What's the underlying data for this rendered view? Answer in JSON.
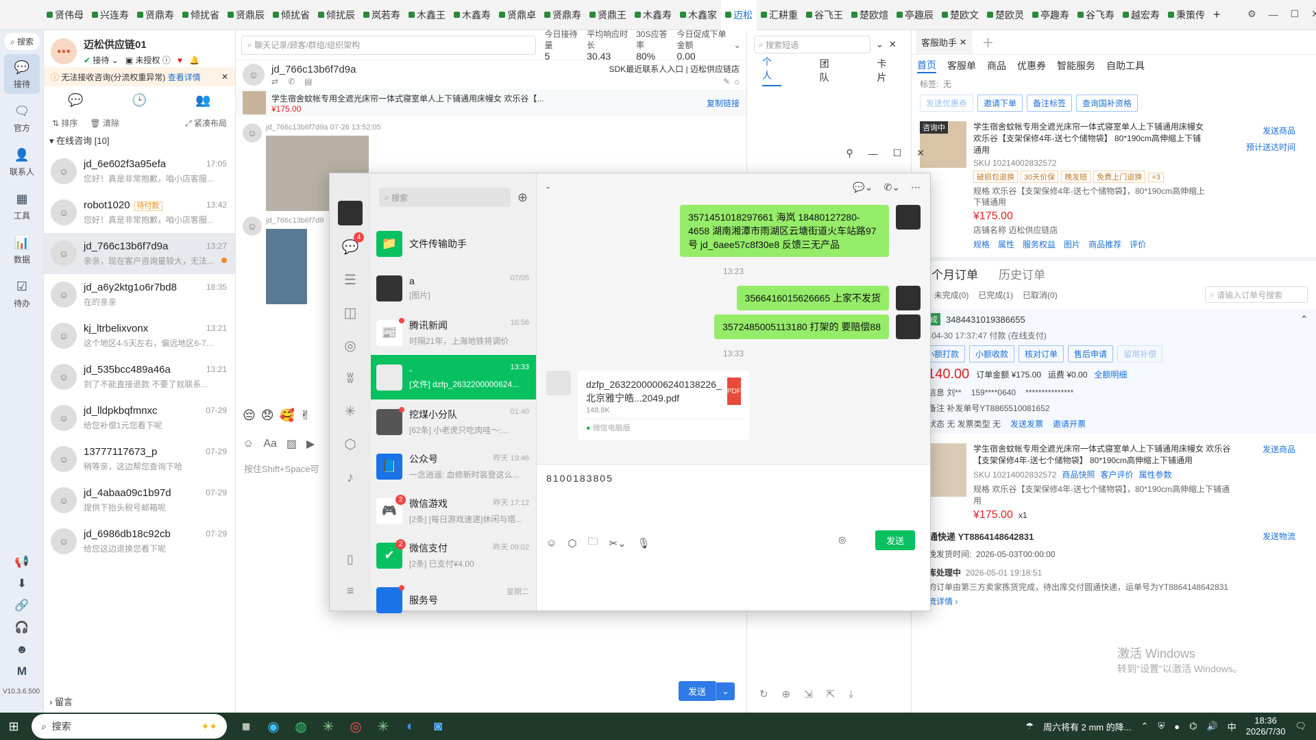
{
  "shop_tabs": [
    "贤伟母",
    "兴连寿",
    "贤鼎寿",
    "倾扰省",
    "贤鼎辰",
    "倾扰省",
    "倾扰辰",
    "岚若寿",
    "木鑫王",
    "木鑫寿",
    "贤鼎卓",
    "贤鼎寿",
    "贤鼎王",
    "木鑫寿",
    "木鑫家",
    "迈松",
    "汇耕重",
    "谷飞王",
    "楚欧煊",
    "亭趣辰",
    "楚欧文",
    "楚欧灵",
    "亭趣寿",
    "谷飞寿",
    "越宏寿",
    "秉策传"
  ],
  "active_tab": "迈松",
  "rail": {
    "search": "搜索",
    "items": [
      {
        "label": "接待",
        "icon": "chat-icon"
      },
      {
        "label": "官方",
        "icon": "message-icon"
      },
      {
        "label": "联系人",
        "icon": "contact-icon"
      },
      {
        "label": "工具",
        "icon": "tools-icon"
      },
      {
        "label": "数据",
        "icon": "data-icon"
      },
      {
        "label": "待办",
        "icon": "todo-icon"
      }
    ],
    "version": "V10.3.6.500",
    "bottom_letter": "M"
  },
  "store": {
    "name": "迈松供应链01",
    "status": "接待",
    "auth": "未授权",
    "warning": "无法接收咨询(分流权重异常)",
    "warning_link": "查看详情",
    "sort": "排序",
    "clear": "清除",
    "layout": "紧凑布局",
    "group": "在线咨询 [10]",
    "leave_msg": "留言"
  },
  "conversations": [
    {
      "name": "jd_6e602f3a95efa",
      "msg": "您好！真是非常抱歉，咱小店客服...",
      "time": "17:05"
    },
    {
      "name": "robot1020",
      "tag": "待付款",
      "msg": "您好！真是非常抱歉，咱小店客服...",
      "time": "13:42"
    },
    {
      "name": "jd_766c13b6f7d9a",
      "msg": "亲亲，现在客户咨询量较大，无法...",
      "time": "13:27"
    },
    {
      "name": "jd_a6y2ktg1o6r7bd8",
      "msg": "在的亲亲",
      "time": "18:35"
    },
    {
      "name": "kj_ltrbelixvonx",
      "msg": "这个地区4-5天左右，偏远地区6-7...",
      "time": "13:21"
    },
    {
      "name": "jd_535bcc489a46a",
      "msg": "到了不能直接退款 不要了就联系...",
      "time": "13:21"
    },
    {
      "name": "jd_lldpkbqfmnxc",
      "msg": "给您补偿1元您看下呢",
      "time": "07-29"
    },
    {
      "name": "13777117673_p",
      "msg": "稍等亲，这边帮您查询下哈",
      "time": "07-29"
    },
    {
      "name": "jd_4abaa09c1b97d",
      "msg": "提供下抬头税号邮箱呢",
      "time": "07-29"
    },
    {
      "name": "jd_6986db18c92cb",
      "msg": "给您这边退换您看下呢",
      "time": "07-29"
    }
  ],
  "chat": {
    "search_placeholder": "聊天记录/顾客/群组/组织架构",
    "stats": [
      {
        "label": "今日接待量",
        "value": "5"
      },
      {
        "label": "平均响应时长",
        "value": "30.43"
      },
      {
        "label": "30S应答率",
        "value": "80%"
      },
      {
        "label": "今日促成下单金额",
        "value": "0.00"
      }
    ],
    "customer": "jd_766c13b6f7d9a",
    "sdk_link": "SDK最近联系人入口",
    "shop_label": "迈松供应链店",
    "product_title": "学生宿舍蚊帐专用全遮光床帘一体式寝室单人上下铺通用床幔女 欢乐谷【...",
    "product_price": "¥175.00",
    "copy_link": "复制链接",
    "msg_user": "jd_766c13b6f7d9a",
    "msg_time": "07-26 13:52:05",
    "msg_user2": "jd_766c13b6f7d9",
    "input_hint": "按住Shift+Space可",
    "send": "发送"
  },
  "sidetools": {
    "search_placeholder": "搜索短语",
    "tabs": [
      "个人",
      "团队",
      "卡片"
    ]
  },
  "right": {
    "tab_title": "客服助手",
    "nav": [
      "首页",
      "客服单",
      "商品",
      "优惠券",
      "智能服务",
      "自助工具"
    ],
    "tag_label": "标签:",
    "tag_value": "无",
    "actions": [
      "发送优惠券",
      "邀请下单",
      "备注标签",
      "查询国补资格"
    ],
    "consult_badge": "咨询中",
    "product_title": "学生宿舍蚊帐专用全遮光床帘一体式寝室单人上下铺通用床幔女 欢乐谷【支架保修4年-送七个储物袋】 80*190cm高伸缩上下铺通用",
    "sku": "SKU 10214002832572",
    "send_product": "发送商品",
    "predict": "预计送达时间",
    "chips": [
      "破损包退换",
      "30天价保",
      "晚发赔",
      "免费上门退换",
      "+3"
    ],
    "spec": "规格 欢乐谷【支架保修4年-送七个储物袋】，80*190cm高伸缩上下铺通用",
    "price": "¥175.00",
    "shop_name": "店铺名称 迈松供应链店",
    "links": [
      "规格",
      "属性",
      "服务权益",
      "图片",
      "商品推荐",
      "评价"
    ],
    "orders_title": "三个月订单",
    "history": "历史订单",
    "filters": [
      "1",
      "未完成(0)",
      "已完成(1)",
      "已取消(0)"
    ],
    "order_search": "请输入订单号搜索",
    "order_status": "完成",
    "order_no": "3484431019386655",
    "order_time": "26-04-30 17:37:47 付款 (在线支付)",
    "order_actions": [
      "小额打款",
      "小额收款",
      "核对订单",
      "售后申请",
      "留用补偿"
    ],
    "paid": "¥140.00",
    "order_amount": "订单金额 ¥175.00",
    "freight": "运费 ¥0.00",
    "detail": "全额明细",
    "receiver": "货信息 刘**",
    "phone": "159****0640",
    "mask": "***************",
    "remark": "家备注 补发单号YT8865510081652",
    "invoice": "票状态 无  发票类型 无",
    "send_invoice": "发送发票",
    "invite_invoice": "邀请开票",
    "item_title": "学生宿舍蚊帐专用全遮光床帘一体式寝室单人上下铺通用床幔女 欢乐谷【支架保修4年-送七个储物袋】 80*190cm高伸缩上下铺通用",
    "item_sku": "SKU 10214002832572",
    "item_links": [
      "商品快照",
      "客户评价",
      "属性参数"
    ],
    "item_spec": "规格 欢乐谷【支架保修4年-送七个储物袋】，80*190cm高伸缩上下铺通用",
    "item_price": "¥175.00",
    "item_qty": "x1",
    "express": "圆通快递 YT8864148642831",
    "send_logistics": "发送物流",
    "latest_ship": "最晚发货时间:",
    "latest_ship_val": "2026-05-03T00:00:00",
    "warehouse": "仓库处理中",
    "warehouse_time": "2026-05-01 19:18:51",
    "logistics_text": "您的订单由第三方卖家拣货完成，待出库交付圆通快递，运单号为YT8864148642831",
    "logistics_detail": "物流详情",
    "watermark1": "激活 Windows",
    "watermark2": "转到\"设置\"以激活 Windows。"
  },
  "wechat": {
    "search_placeholder": "搜索",
    "chat_title": "-",
    "rail_badge": "4",
    "list": [
      {
        "name": "文件传输助手",
        "preview": "",
        "time": "",
        "color": "#07c160",
        "icon": "📁"
      },
      {
        "name": "a",
        "preview": "[图片]",
        "time": "07/05",
        "color": "#333",
        "icon": ""
      },
      {
        "name": "腾讯新闻",
        "preview": "时隔21年，上海地铁将调价",
        "time": "16:56",
        "color": "#fff",
        "icon": "📰",
        "dot": true
      },
      {
        "name": "-",
        "preview": "[文件] dzfp_2632200000624...",
        "time": "13:33",
        "color": "#eaeaea",
        "icon": "",
        "sel": true
      },
      {
        "name": "挖煤小分队",
        "preview": "[62条] 小老虎只吃肉哇～:...",
        "time": "01:40",
        "color": "#555",
        "icon": "",
        "dot": true
      },
      {
        "name": "公众号",
        "preview": "一念逍遥: 血修新时装登这么...",
        "time": "昨天 19:46",
        "color": "#1a73e8",
        "icon": "📘"
      },
      {
        "name": "微信游戏",
        "preview": "[2条] [每日游戏速递]休闲与塔...",
        "time": "昨天 17:12",
        "color": "#fff",
        "icon": "🎮",
        "badge": "2"
      },
      {
        "name": "微信支付",
        "preview": "[2条] 已支付¥4.00",
        "time": "昨天 09:02",
        "color": "#07c160",
        "icon": "✔",
        "badge": "2"
      },
      {
        "name": "服务号",
        "preview": "",
        "time": "星期二",
        "color": "#1a73e8",
        "icon": "",
        "dot": true
      }
    ],
    "messages": [
      {
        "text": "3571451018297661  海岚 18480127280-4658 湖南湘潭市雨湖区云塘街道火车站路97号  jd_6aee57c8f30e8 反馈三无产品"
      },
      {
        "time": "13:23"
      },
      {
        "text": "3566416015626665  上家不发货"
      },
      {
        "text": "3572485005113180  打架的 要赔偿88"
      },
      {
        "time": "13:33"
      }
    ],
    "file": {
      "name": "dzfp_26322000006240138226_北京雅宁皓...2049.pdf",
      "size": "148.8K",
      "source": "微信电脑版",
      "type": "PDF"
    },
    "input_text": "8100183805",
    "send": "发送"
  },
  "taskbar": {
    "search": "搜索",
    "weather": "周六将有 2 mm 的降...",
    "time": "18:36",
    "date": "2026/7/30",
    "ime": "中"
  }
}
